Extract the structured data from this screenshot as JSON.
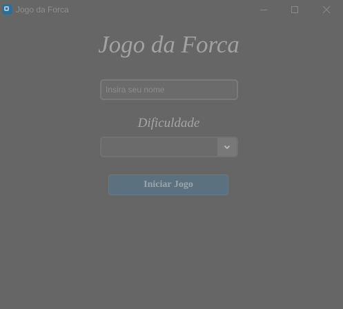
{
  "window": {
    "title": "Jogo da Forca",
    "app_icon": "app-icon",
    "controls": [
      "minimize-icon",
      "maximize-icon",
      "close-icon"
    ]
  },
  "main": {
    "heading": "Jogo da Forca",
    "name_input": {
      "placeholder": "Insira seu nome",
      "value": ""
    },
    "difficulty": {
      "label": "Dificuldade",
      "selected": "",
      "icon": "chevron-down-icon"
    },
    "start_button": "Iniciar Jogo"
  },
  "colors": {
    "background": "#666666",
    "accent_button": "#5c7180",
    "app_icon": "#2f6f95"
  }
}
